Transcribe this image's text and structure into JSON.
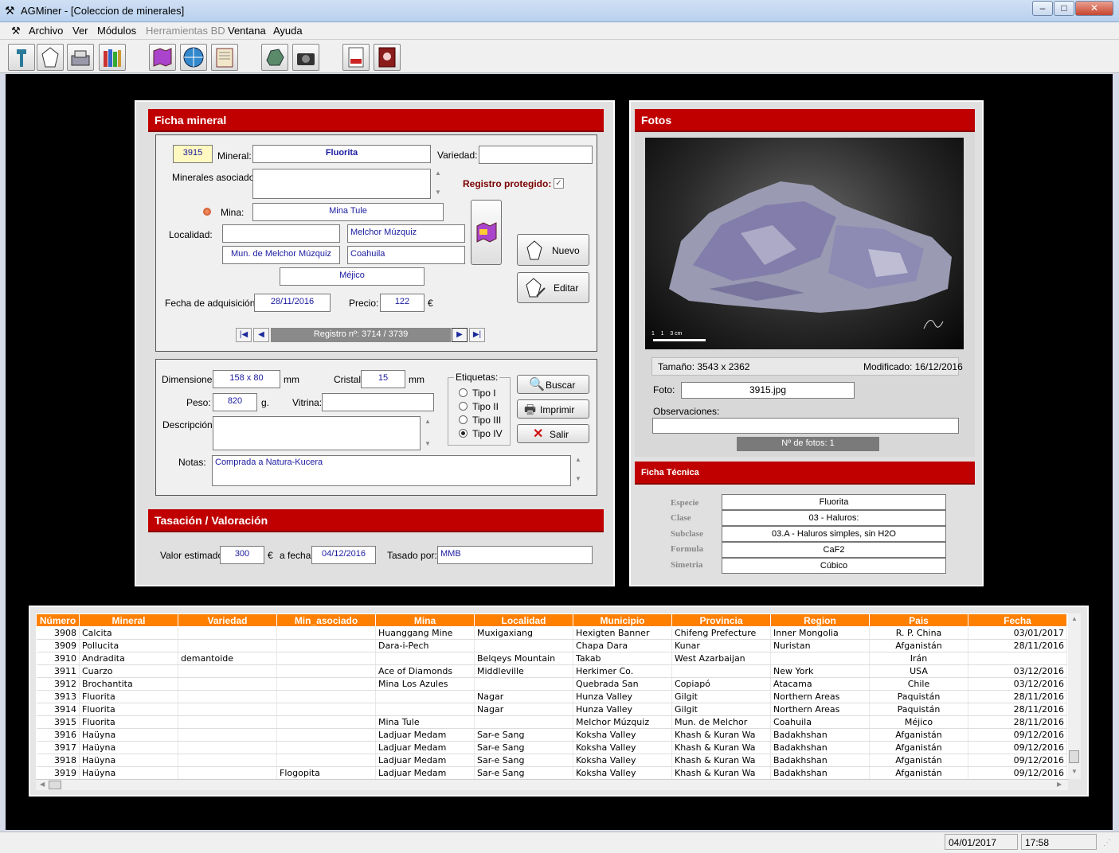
{
  "window": {
    "title": "AGMiner - [Coleccion de minerales]"
  },
  "menu": [
    "Archivo",
    "Ver",
    "Módulos",
    "Herramientas BD",
    "Ventana",
    "Ayuda"
  ],
  "ficha": {
    "header": "Ficha mineral",
    "numero": "3915",
    "mineral_label": "Mineral:",
    "mineral": "Fluorita",
    "variedad_label": "Variedad:",
    "variedad": "",
    "asociados_label": "Minerales asociados:",
    "asociados": "",
    "protegido_label": "Registro protegido:",
    "mina_label": "Mina:",
    "mina": "Mina Tule",
    "localidad_label": "Localidad:",
    "localidad": "",
    "localidad2": "Melchor Múzquiz",
    "municipio": "Mun. de Melchor Múzquiz",
    "provincia": "Coahuila",
    "pais": "Méjico",
    "fecha_label": "Fecha de adquisición:",
    "fecha": "28/11/2016",
    "precio_label": "Precio:",
    "precio": "122",
    "moneda": "€",
    "nuevo": "Nuevo",
    "editar": "Editar",
    "registro": "Registro nº: 3714 / 3739",
    "dim_label": "Dimensiones:",
    "dimensiones": "158 x 80",
    "mm": "mm",
    "cristal_label": "Cristal:",
    "cristal": "15",
    "peso_label": "Peso:",
    "peso": "820",
    "g": "g.",
    "vitrina_label": "Vitrina:",
    "vitrina": "",
    "desc_label": "Descripción:",
    "descripcion": "",
    "notas_label": "Notas:",
    "notas": "Comprada a Natura-Kucera",
    "etiquetas_label": "Etiquetas:",
    "tipos": [
      "Tipo I",
      "Tipo II",
      "Tipo III",
      "Tipo IV"
    ],
    "buscar": "Buscar",
    "imprimir": "Imprimir",
    "salir": "Salir"
  },
  "tasacion": {
    "header": "Tasación / Valoración",
    "valor_label": "Valor estimado:",
    "valor": "300",
    "moneda": "€",
    "fecha_label": "a fecha:",
    "fecha": "04/12/2016",
    "tasado_label": "Tasado por:",
    "tasado": "MMB"
  },
  "fotos": {
    "header": "Fotos",
    "tamano": "Tamaño: 3543 x 2362",
    "modificado": "Modificado: 16/12/2016",
    "foto_label": "Foto:",
    "foto": "3915.jpg",
    "obs_label": "Observaciones:",
    "nfotos": "Nº de fotos: 1",
    "scale_text": "1    1    3 cm"
  },
  "tecnica": {
    "header": "Ficha Técnica",
    "rows": [
      {
        "k": "Especie",
        "v": "Fluorita"
      },
      {
        "k": "Clase",
        "v": "03 - Haluros:"
      },
      {
        "k": "Subclase",
        "v": "03.A - Haluros simples, sin H2O"
      },
      {
        "k": "Formula",
        "v": "CaF2"
      },
      {
        "k": "Simetria",
        "v": "Cúbico"
      }
    ]
  },
  "grid": {
    "columns": [
      "Número",
      "Mineral",
      "Variedad",
      "Min_asociado",
      "Mina",
      "Localidad",
      "Municipio",
      "Provincia",
      "Region",
      "Pais",
      "Fecha"
    ],
    "rows": [
      [
        "3908",
        "Calcita",
        "",
        "",
        "Huanggang Mine",
        "Muxigaxiang",
        "Hexigten Banner",
        "Chifeng Prefecture",
        "Inner Mongolia",
        "R. P. China",
        "03/01/2017"
      ],
      [
        "3909",
        "Pollucita",
        "",
        "",
        "Dara-i-Pech",
        "",
        "Chapa Dara",
        "Kunar",
        "Nuristan",
        "Afganistán",
        "28/11/2016"
      ],
      [
        "3910",
        "Andradita",
        "demantoide",
        "",
        "",
        "Belqeys Mountain",
        "Takab",
        "West Azarbaijan",
        "",
        "Irán",
        ""
      ],
      [
        "3911",
        "Cuarzo",
        "",
        "",
        "Ace of Diamonds",
        "Middleville",
        "Herkimer Co.",
        "",
        "New York",
        "USA",
        "03/12/2016"
      ],
      [
        "3912",
        "Brochantita",
        "",
        "",
        "Mina Los Azules",
        "",
        "Quebrada San",
        "Copiapó",
        "Atacama",
        "Chile",
        "03/12/2016"
      ],
      [
        "3913",
        "Fluorita",
        "",
        "",
        "",
        "Nagar",
        "Hunza Valley",
        "Gilgit",
        "Northern Areas",
        "Paquistán",
        "28/11/2016"
      ],
      [
        "3914",
        "Fluorita",
        "",
        "",
        "",
        "Nagar",
        "Hunza Valley",
        "Gilgit",
        "Northern Areas",
        "Paquistán",
        "28/11/2016"
      ],
      [
        "3915",
        "Fluorita",
        "",
        "",
        "Mina Tule",
        "",
        "Melchor Múzquiz",
        "Mun. de Melchor",
        "Coahuila",
        "Méjico",
        "28/11/2016"
      ],
      [
        "3916",
        "Haüyna",
        "",
        "",
        "Ladjuar Medam",
        "Sar-e Sang",
        "Koksha Valley",
        "Khash & Kuran Wa",
        "Badakhshan",
        "Afganistán",
        "09/12/2016"
      ],
      [
        "3917",
        "Haüyna",
        "",
        "",
        "Ladjuar Medam",
        "Sar-e Sang",
        "Koksha Valley",
        "Khash & Kuran Wa",
        "Badakhshan",
        "Afganistán",
        "09/12/2016"
      ],
      [
        "3918",
        "Haüyna",
        "",
        "",
        "Ladjuar Medam",
        "Sar-e Sang",
        "Koksha Valley",
        "Khash & Kuran Wa",
        "Badakhshan",
        "Afganistán",
        "09/12/2016"
      ],
      [
        "3919",
        "Haüyna",
        "",
        "Flogopita",
        "Ladjuar Medam",
        "Sar-e Sang",
        "Koksha Valley",
        "Khash & Kuran Wa",
        "Badakhshan",
        "Afganistán",
        "09/12/2016"
      ]
    ]
  },
  "status": {
    "date": "04/01/2017",
    "time": "17:58"
  }
}
